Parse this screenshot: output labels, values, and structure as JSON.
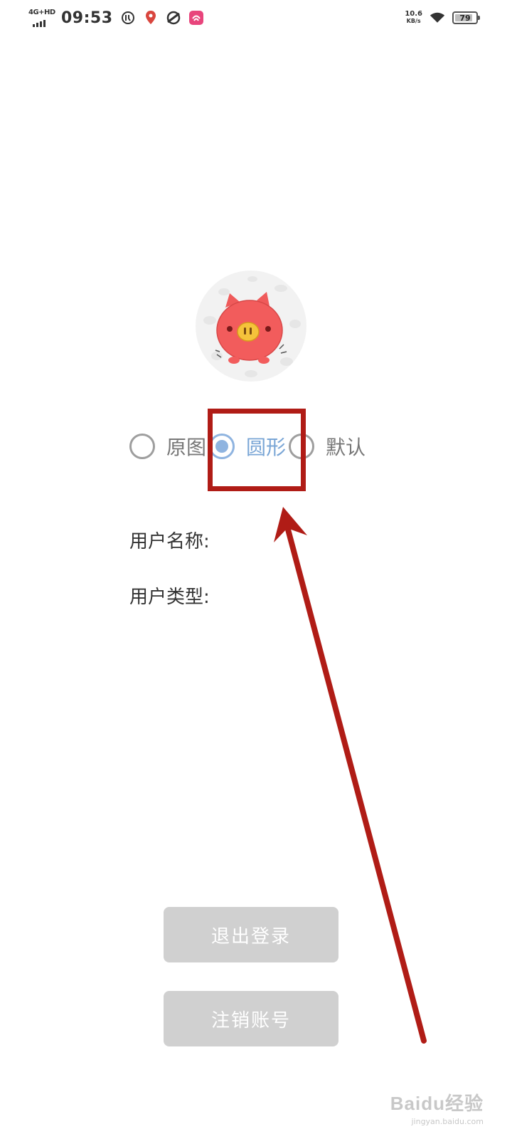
{
  "status_bar": {
    "network": "4G+HD",
    "time": "09:53",
    "speed_value": "10.6",
    "speed_unit": "KB/s",
    "battery_level": "79",
    "icons": [
      "data-saver-icon",
      "location-pin-icon",
      "sync-icon",
      "app-notification-icon",
      "wifi-icon",
      "battery-icon"
    ]
  },
  "profile": {
    "avatar_icon": "pig-avatar-icon",
    "avatar_shape_options": [
      {
        "label": "原图",
        "checked": false
      },
      {
        "label": "圆形",
        "checked": true
      },
      {
        "label": "默认",
        "checked": false
      }
    ],
    "username_label": "用户名称:",
    "usertype_label": "用户类型:"
  },
  "actions": {
    "logout_label": "退出登录",
    "cancel_account_label": "注销账号"
  },
  "watermark": {
    "logo": "Baidu经验",
    "url": "jingyan.baidu.com"
  },
  "colors": {
    "accent": "#8fb4e0",
    "button_bg": "#d0d0d0",
    "annotation": "#b01c16"
  }
}
